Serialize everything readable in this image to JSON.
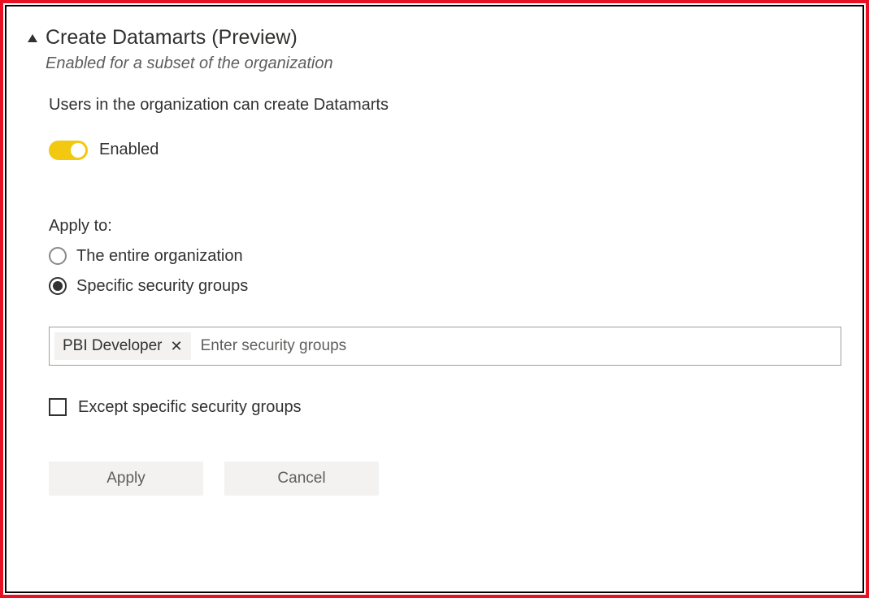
{
  "setting": {
    "title": "Create Datamarts (Preview)",
    "subtitle": "Enabled for a subset of the organization",
    "description": "Users in the organization can create Datamarts",
    "toggle": {
      "state": "on",
      "label": "Enabled"
    },
    "applyTo": {
      "label": "Apply to:",
      "options": {
        "entireOrg": "The entire organization",
        "specificGroups": "Specific security groups"
      },
      "selected": "specificGroups"
    },
    "securityGroups": {
      "tags": [
        {
          "name": "PBI Developer"
        }
      ],
      "placeholder": "Enter security groups"
    },
    "exceptCheckbox": {
      "label": "Except specific security groups",
      "checked": false
    },
    "buttons": {
      "apply": "Apply",
      "cancel": "Cancel"
    }
  }
}
